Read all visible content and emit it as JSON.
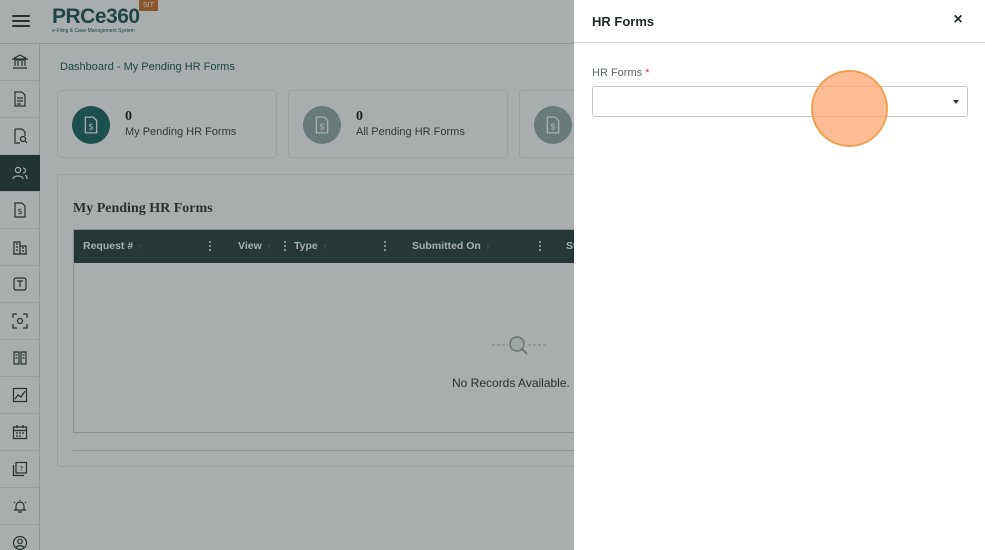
{
  "app": {
    "logo_text": "PRCe360",
    "logo_subtitle": "e-Filing & Case Management System",
    "env_badge": "SIT"
  },
  "sidebar": {
    "items": [
      {
        "icon": "bank-icon"
      },
      {
        "icon": "document-icon"
      },
      {
        "icon": "document-search-icon"
      },
      {
        "icon": "users-icon",
        "active": true
      },
      {
        "icon": "dollar-document-icon"
      },
      {
        "icon": "building-icon"
      },
      {
        "icon": "text-box-icon"
      },
      {
        "icon": "scan-icon"
      },
      {
        "icon": "book-icon"
      },
      {
        "icon": "chart-icon"
      },
      {
        "icon": "calendar-icon"
      },
      {
        "icon": "help-document-icon"
      },
      {
        "icon": "alarm-icon"
      },
      {
        "icon": "profile-icon"
      }
    ]
  },
  "main": {
    "breadcrumb": "Dashboard - My Pending HR Forms",
    "cards": [
      {
        "count": "0",
        "label": "My Pending HR Forms",
        "color": "#0f5e5a"
      },
      {
        "count": "0",
        "label": "All Pending HR Forms",
        "color": "#8fa8a5"
      },
      {
        "count": "",
        "label": "",
        "color": "#8fa8a5"
      }
    ],
    "panel_title": "My Pending HR Forms",
    "table": {
      "columns": [
        "Request #",
        "View",
        "Type",
        "Submitted On",
        "St"
      ],
      "empty_text": "No Records Available."
    }
  },
  "drawer": {
    "title": "HR Forms",
    "field_label": "HR Forms",
    "required_mark": "*",
    "select_value": "",
    "close_label": "×"
  },
  "colors": {
    "brand": "#0f4e4b",
    "sidebar_active": "#14312e",
    "table_header": "#1d3532",
    "badge": "#c8691f",
    "required": "#d0342c"
  }
}
